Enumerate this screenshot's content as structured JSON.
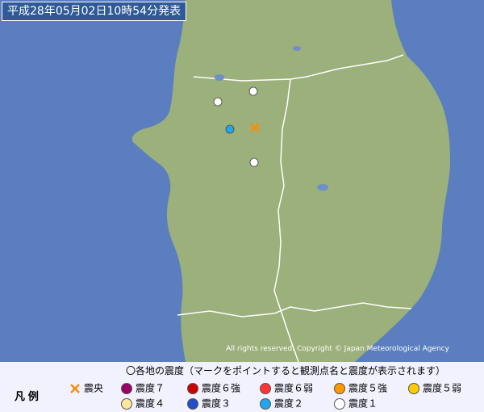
{
  "header": {
    "timestamp": "平成28年05月02日10時54分発表"
  },
  "map": {
    "credit": "All rights reserved. Copyright © Japan Meteorological Agency",
    "colors": {
      "sea": "#5a7ec0",
      "land": "#9bb07a",
      "border": "#ffffff",
      "lake": "#6f8fc8"
    }
  },
  "markers": [
    {
      "kind": "intensity-1"
    },
    {
      "kind": "intensity-1"
    },
    {
      "kind": "intensity-1"
    },
    {
      "kind": "intensity-2"
    },
    {
      "kind": "epicenter"
    }
  ],
  "legend": {
    "heading": "〇各地の震度（マークをポイントすると観測点名と震度が表示されます）",
    "label": "凡例",
    "items": [
      {
        "name": "epicenter",
        "label": "震央",
        "color": "#ff8c00"
      },
      {
        "name": "intensity-7",
        "label": "震度７",
        "color": "#990066"
      },
      {
        "name": "intensity-6-upper",
        "label": "震度６強",
        "color": "#cc0000"
      },
      {
        "name": "intensity-6-lower",
        "label": "震度６弱",
        "color": "#ff3333"
      },
      {
        "name": "intensity-5-upper",
        "label": "震度５強",
        "color": "#ff9900"
      },
      {
        "name": "intensity-5-lower",
        "label": "震度５弱",
        "color": "#ffcc00"
      },
      {
        "name": "intensity-4",
        "label": "震度４",
        "color": "#ffe699"
      },
      {
        "name": "intensity-3",
        "label": "震度３",
        "color": "#1f4fcc"
      },
      {
        "name": "intensity-2",
        "label": "震度２",
        "color": "#22a6f0"
      },
      {
        "name": "intensity-1",
        "label": "震度１",
        "color": "#ffffff"
      }
    ]
  }
}
